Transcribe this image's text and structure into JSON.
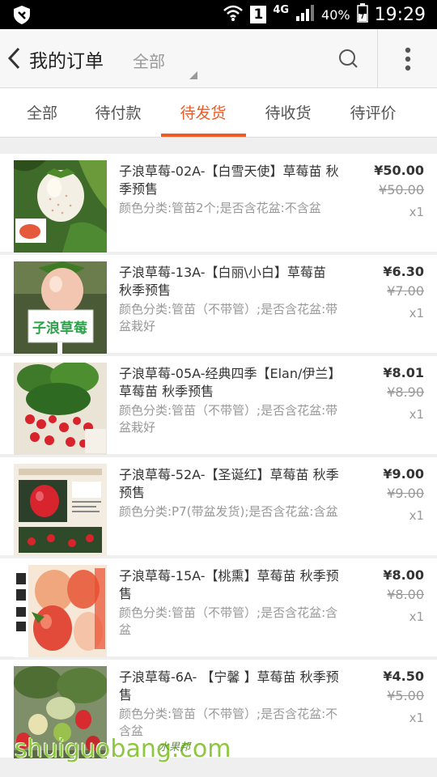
{
  "status_bar": {
    "signal_box": "1",
    "network": "4G",
    "battery": "40%",
    "time": "19:29"
  },
  "header": {
    "title": "我的订单",
    "filter": "全部"
  },
  "tabs": [
    {
      "label": "全部",
      "active": false
    },
    {
      "label": "待付款",
      "active": false
    },
    {
      "label": "待发货",
      "active": true
    },
    {
      "label": "待收货",
      "active": false
    },
    {
      "label": "待评价",
      "active": false
    }
  ],
  "orders": [
    {
      "title": "子浪草莓-02A-【白雪天使】草莓苗 秋季预售",
      "spec": "颜色分类:管苗2个;是否含花盆:不含盆",
      "price": "¥50.00",
      "old_price": "¥50.00",
      "qty": "x1"
    },
    {
      "title": "子浪草莓-13A-【白丽\\小白】草莓苗 秋季预售",
      "spec": "颜色分类:管苗（不带管）;是否含花盆:带盆栽好",
      "price": "¥6.30",
      "old_price": "¥7.00",
      "qty": "x1",
      "thumb_label": "子浪草莓"
    },
    {
      "title": "子浪草莓-05A-经典四季【Elan/伊兰】草莓苗 秋季预售",
      "spec": "颜色分类:管苗（不带管）;是否含花盆:带盆栽好",
      "price": "¥8.01",
      "old_price": "¥8.90",
      "qty": "x1"
    },
    {
      "title": "子浪草莓-52A-【圣诞红】草莓苗 秋季预售",
      "spec": "颜色分类:P7(带盆发货);是否含花盆:含盆",
      "price": "¥9.00",
      "old_price": "¥9.00",
      "qty": "x1"
    },
    {
      "title": "子浪草莓-15A-【桃熏】草莓苗 秋季预售",
      "spec": "颜色分类:管苗（不带管）;是否含花盆:含盆",
      "price": "¥8.00",
      "old_price": "¥8.00",
      "qty": "x1"
    },
    {
      "title": "子浪草莓-6A- 【宁馨 】草莓苗 秋季预售",
      "spec": "颜色分类:管苗（不带管）;是否含花盆:不含盆",
      "price": "¥4.50",
      "old_price": "¥5.00",
      "qty": "x1"
    }
  ],
  "watermark": {
    "text": "shuiguobang.com",
    "cn": "水果邦"
  },
  "colors": {
    "accent": "#f05a24",
    "muted": "#999999",
    "bg": "#efefef"
  }
}
